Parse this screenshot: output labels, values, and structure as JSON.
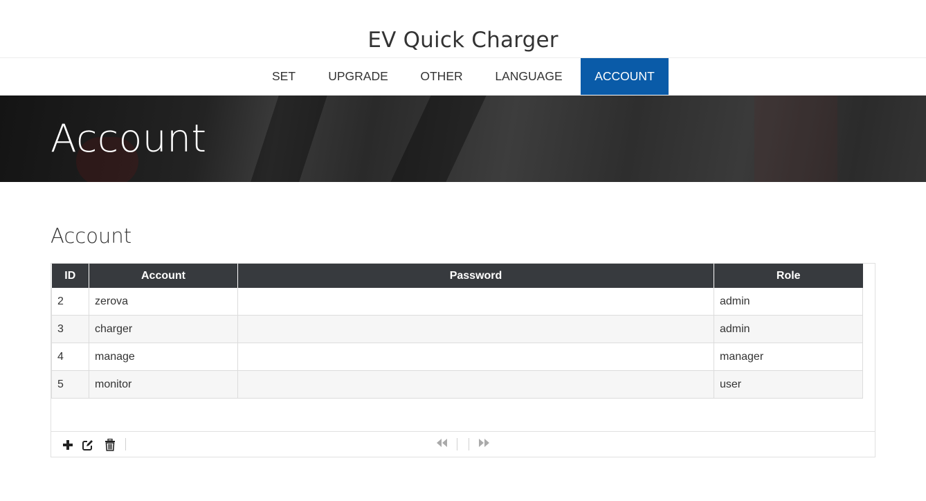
{
  "header": {
    "title": "EV Quick Charger"
  },
  "nav": {
    "items": [
      {
        "label": "SET"
      },
      {
        "label": "UPGRADE"
      },
      {
        "label": "OTHER"
      },
      {
        "label": "LANGUAGE"
      },
      {
        "label": "ACCOUNT",
        "active": true
      }
    ]
  },
  "banner": {
    "title": "Account"
  },
  "section": {
    "title": "Account"
  },
  "table": {
    "columns": [
      "ID",
      "Account",
      "Password",
      "Role"
    ],
    "rows": [
      {
        "id": "2",
        "account": "zerova",
        "password": "",
        "role": "admin"
      },
      {
        "id": "3",
        "account": "charger",
        "password": "",
        "role": "admin"
      },
      {
        "id": "4",
        "account": "manage",
        "password": "",
        "role": "manager"
      },
      {
        "id": "5",
        "account": "monitor",
        "password": "",
        "role": "user"
      }
    ]
  },
  "pager": {
    "add_icon": "plus-icon",
    "edit_icon": "edit-icon",
    "delete_icon": "trash-icon",
    "first_icon": "first-page-icon",
    "last_icon": "last-page-icon"
  },
  "colors": {
    "accent": "#0a5ba8",
    "table_header": "#373a3e"
  }
}
